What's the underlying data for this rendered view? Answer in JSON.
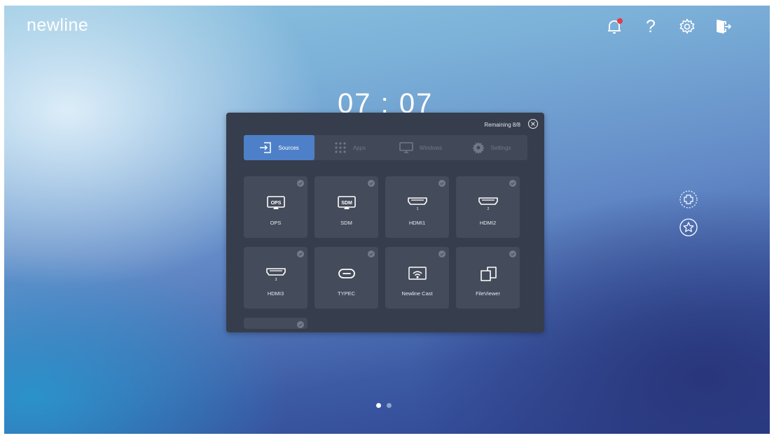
{
  "brand": {
    "logo": "newline"
  },
  "top_bar": {
    "icons": [
      "bell-icon",
      "help-icon",
      "gear-icon",
      "exit-icon"
    ],
    "help_glyph": "?",
    "notification_dot_color": "#e53b4b"
  },
  "clock": {
    "time": "07 : 07"
  },
  "panel": {
    "remaining": "Remaining 8/8",
    "tabs": [
      {
        "label": "Sources",
        "icon": "input-icon",
        "active": true
      },
      {
        "label": "Apps",
        "icon": "apps-grid-icon",
        "active": false
      },
      {
        "label": "Windows",
        "icon": "monitor-icon",
        "active": false
      },
      {
        "label": "Settings",
        "icon": "gear-icon",
        "active": false
      }
    ],
    "sources": [
      {
        "label": "OPS",
        "icon": "ops-icon",
        "icon_text": "OPS"
      },
      {
        "label": "SDM",
        "icon": "sdm-icon",
        "icon_text": "SDM"
      },
      {
        "label": "HDMI1",
        "icon": "hdmi-icon",
        "icon_text": "1"
      },
      {
        "label": "HDMI2",
        "icon": "hdmi-icon",
        "icon_text": "2"
      },
      {
        "label": "HDMI3",
        "icon": "hdmi-icon",
        "icon_text": "3"
      },
      {
        "label": "TYPEC",
        "icon": "usb-c-icon"
      },
      {
        "label": "Newline Cast",
        "icon": "cast-icon"
      },
      {
        "label": "FileViewer",
        "icon": "file-viewer-icon"
      }
    ],
    "active_tab_color": "#4d80c8"
  },
  "side_buttons": [
    "add-icon",
    "star-icon"
  ],
  "pager": {
    "pages": 2,
    "current": 1
  }
}
